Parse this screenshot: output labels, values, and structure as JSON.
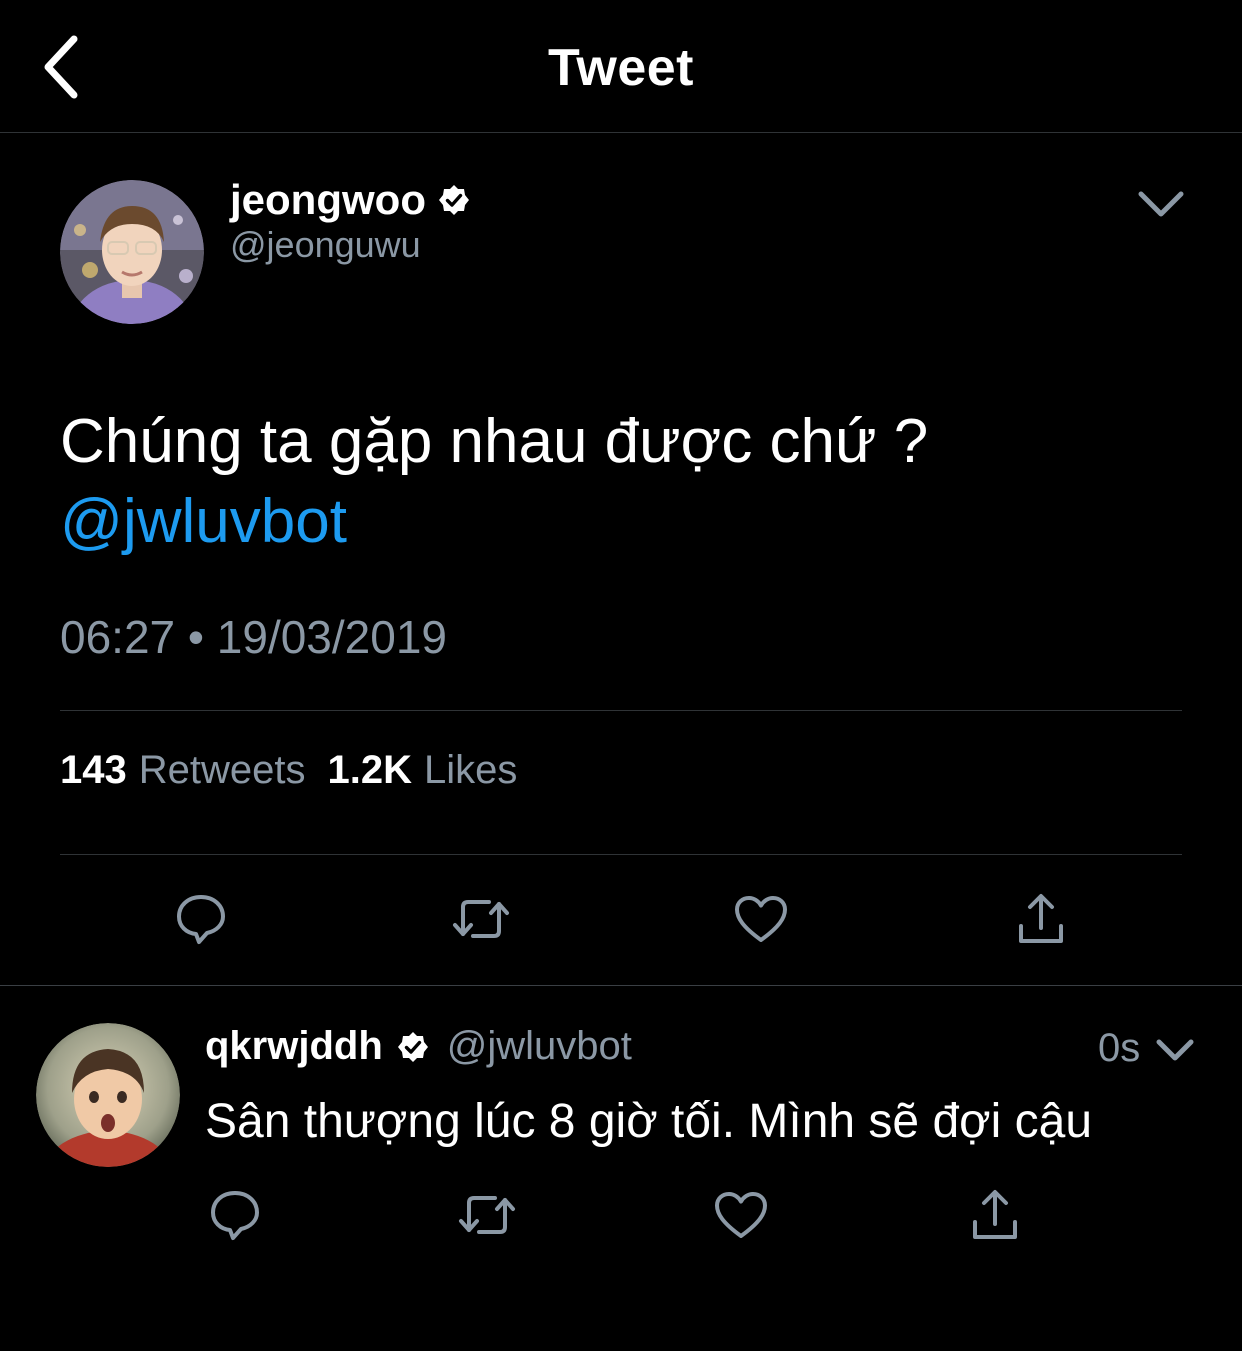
{
  "header": {
    "title": "Tweet",
    "back_icon": "chevron-left-icon"
  },
  "main_tweet": {
    "author_name": "jeongwoo",
    "verified": true,
    "handle": "@jeonguwu",
    "text": "Chúng ta gặp nhau được chứ ?",
    "mention": "@jwluvbot",
    "timestamp": "06:27 • 19/03/2019",
    "stats": {
      "retweets_count": "143",
      "retweets_label": "Retweets",
      "likes_count": "1.2K",
      "likes_label": "Likes"
    },
    "actions": [
      "reply-icon",
      "retweet-icon",
      "like-icon",
      "share-icon"
    ]
  },
  "reply_tweet": {
    "author_name": "qkrwjddh",
    "verified": true,
    "handle": "@jwluvbot",
    "time": "0s",
    "text": "Sân thượng lúc 8 giờ tối. Mình sẽ đợi cậu",
    "actions": [
      "reply-icon",
      "retweet-icon",
      "like-icon",
      "share-icon"
    ]
  },
  "colors": {
    "background": "#000000",
    "text_primary": "#ffffff",
    "text_secondary": "#8b98a5",
    "accent": "#1d9bf0",
    "divider": "#2f3336"
  }
}
